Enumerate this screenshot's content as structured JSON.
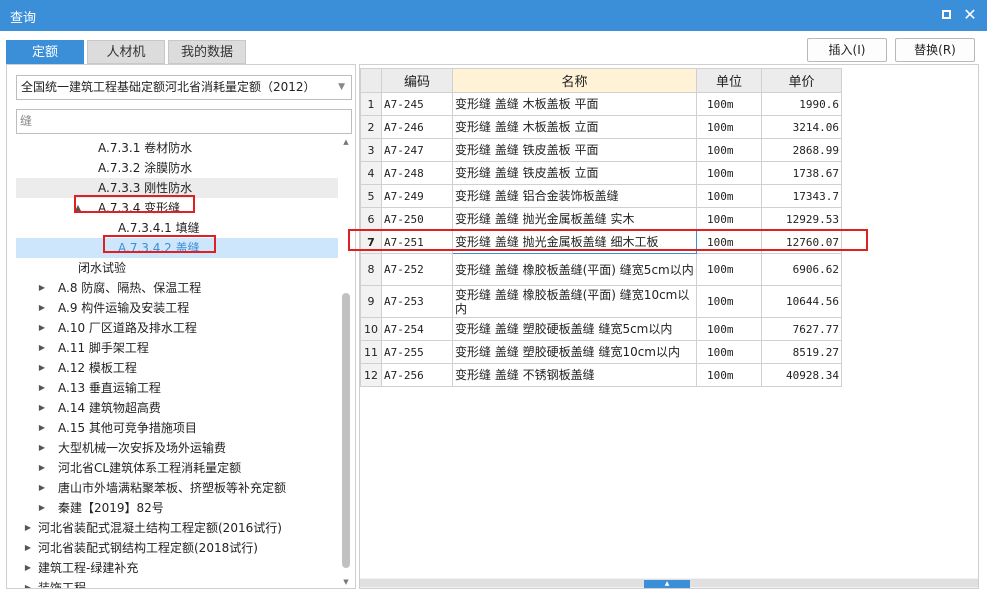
{
  "window": {
    "title": "查询"
  },
  "tabs": [
    "定额",
    "人材机",
    "我的数据"
  ],
  "actions": {
    "insert": "插入(I)",
    "replace": "替换(R)"
  },
  "left": {
    "library": "全国统一建筑工程基础定额河北省消耗量定额（2012）",
    "search_value": "缝",
    "tree": [
      {
        "label": "A.7.3.1 卷材防水",
        "level": 3,
        "arrow": ""
      },
      {
        "label": "A.7.3.2 涂膜防水",
        "level": 3,
        "arrow": ""
      },
      {
        "label": "A.7.3.3 刚性防水",
        "level": 3,
        "arrow": ""
      },
      {
        "label": "A.7.3.4 变形缝",
        "level": 3,
        "arrow": "▲"
      },
      {
        "label": "A.7.3.4.1 填缝",
        "level": 4,
        "arrow": ""
      },
      {
        "label": "A.7.3.4.2 盖缝",
        "level": 4,
        "arrow": ""
      },
      {
        "label": "闭水试验",
        "level": 2,
        "arrow": ""
      },
      {
        "label": "A.8 防腐、隔热、保温工程",
        "level": 1,
        "arrow": "▶"
      },
      {
        "label": "A.9 构件运输及安装工程",
        "level": 1,
        "arrow": "▶"
      },
      {
        "label": "A.10 厂区道路及排水工程",
        "level": 1,
        "arrow": "▶"
      },
      {
        "label": "A.11 脚手架工程",
        "level": 1,
        "arrow": "▶"
      },
      {
        "label": "A.12 模板工程",
        "level": 1,
        "arrow": "▶"
      },
      {
        "label": "A.13 垂直运输工程",
        "level": 1,
        "arrow": "▶"
      },
      {
        "label": "A.14 建筑物超高费",
        "level": 1,
        "arrow": "▶"
      },
      {
        "label": "A.15 其他可竞争措施项目",
        "level": 1,
        "arrow": "▶"
      },
      {
        "label": "大型机械一次安拆及场外运输费",
        "level": 1,
        "arrow": "▶"
      },
      {
        "label": "河北省CL建筑体系工程消耗量定额",
        "level": 1,
        "arrow": "▶"
      },
      {
        "label": "唐山市外墙满粘聚苯板、挤塑板等补充定额",
        "level": 1,
        "arrow": "▶"
      },
      {
        "label": "秦建【2019】82号",
        "level": 1,
        "arrow": "▶"
      },
      {
        "label": "河北省装配式混凝土结构工程定额(2016试行)",
        "level": 0,
        "arrow": "▶"
      },
      {
        "label": "河北省装配式钢结构工程定额(2018试行)",
        "level": 0,
        "arrow": "▶"
      },
      {
        "label": "建筑工程-绿建补充",
        "level": 0,
        "arrow": "▶"
      },
      {
        "label": "装饰工程",
        "level": 0,
        "arrow": "▶"
      }
    ]
  },
  "grid": {
    "columns": [
      "编码",
      "名称",
      "单位",
      "单价"
    ],
    "rows": [
      {
        "idx": "1",
        "code": "A7-245",
        "name": "变形缝 盖缝 木板盖板 平面",
        "unit": "100m",
        "price": "1990.6"
      },
      {
        "idx": "2",
        "code": "A7-246",
        "name": "变形缝 盖缝 木板盖板 立面",
        "unit": "100m",
        "price": "3214.06"
      },
      {
        "idx": "3",
        "code": "A7-247",
        "name": "变形缝 盖缝 铁皮盖板 平面",
        "unit": "100m",
        "price": "2868.99"
      },
      {
        "idx": "4",
        "code": "A7-248",
        "name": "变形缝 盖缝 铁皮盖板 立面",
        "unit": "100m",
        "price": "1738.67"
      },
      {
        "idx": "5",
        "code": "A7-249",
        "name": "变形缝 盖缝 铝合金装饰板盖缝",
        "unit": "100m",
        "price": "17343.7"
      },
      {
        "idx": "6",
        "code": "A7-250",
        "name": "变形缝 盖缝 抛光金属板盖缝 实木",
        "unit": "100m",
        "price": "12929.53"
      },
      {
        "idx": "7",
        "code": "A7-251",
        "name": "变形缝 盖缝 抛光金属板盖缝 细木工板",
        "unit": "100m",
        "price": "12760.07"
      },
      {
        "idx": "8",
        "code": "A7-252",
        "name": "变形缝 盖缝 橡胶板盖缝(平面) 缝宽5cm以内",
        "unit": "100m",
        "price": "6906.62"
      },
      {
        "idx": "9",
        "code": "A7-253",
        "name": "变形缝 盖缝 橡胶板盖缝(平面) 缝宽10cm以内",
        "unit": "100m",
        "price": "10644.56"
      },
      {
        "idx": "10",
        "code": "A7-254",
        "name": "变形缝 盖缝 塑胶硬板盖缝 缝宽5cm以内",
        "unit": "100m",
        "price": "7627.77"
      },
      {
        "idx": "11",
        "code": "A7-255",
        "name": "变形缝 盖缝 塑胶硬板盖缝 缝宽10cm以内",
        "unit": "100m",
        "price": "8519.27"
      },
      {
        "idx": "12",
        "code": "A7-256",
        "name": "变形缝 盖缝 不锈钢板盖缝",
        "unit": "100m",
        "price": "40928.34"
      }
    ]
  }
}
